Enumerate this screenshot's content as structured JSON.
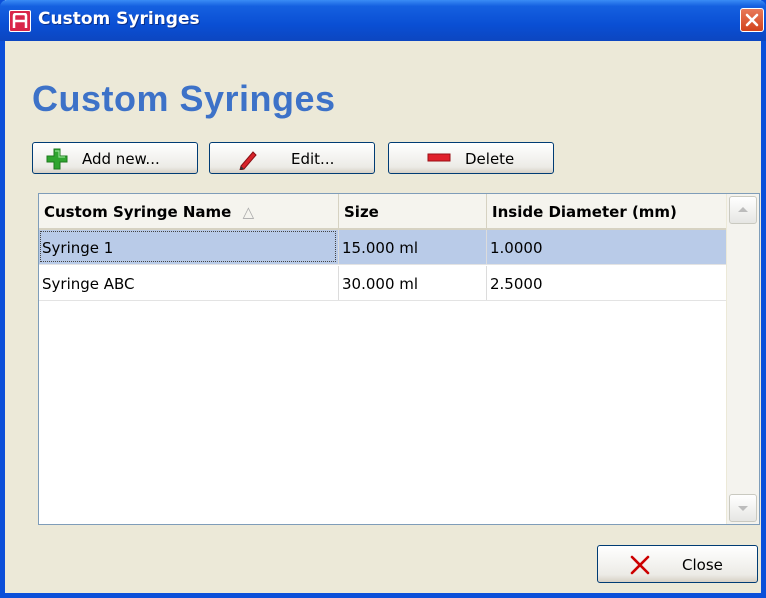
{
  "window": {
    "title": "Custom Syringes"
  },
  "heading": "Custom Syringes",
  "toolbar": {
    "add_label": "Add new...",
    "edit_label": "Edit...",
    "delete_label": "Delete"
  },
  "table": {
    "columns": [
      "Custom Syringe Name",
      "Size",
      "Inside Diameter (mm)"
    ],
    "sort_indicator": "△",
    "rows": [
      {
        "name": "Syringe 1",
        "size": "15.000 ml",
        "diameter": "1.0000",
        "selected": true
      },
      {
        "name": "Syringe ABC",
        "size": "30.000 ml",
        "diameter": "2.5000",
        "selected": false
      }
    ]
  },
  "close_label": "Close",
  "colors": {
    "titlebar": "#0a4fd4",
    "heading": "#3d72c8",
    "selection": "#b9cbe8",
    "close_icon": "#cc0000",
    "add_icon": "#2fa52f",
    "delete_icon": "#e0202a"
  }
}
